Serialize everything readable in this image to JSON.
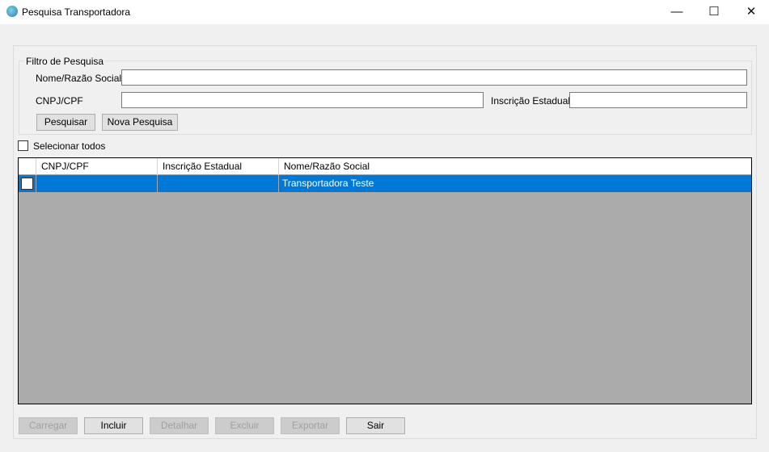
{
  "window": {
    "title": "Pesquisa Transportadora",
    "minimize": "—",
    "maximize": "☐",
    "close": "✕"
  },
  "filter": {
    "legend": "Filtro de Pesquisa",
    "nome_label": "Nome/Razão Social",
    "nome_value": "",
    "cnpj_label": "CNPJ/CPF",
    "cnpj_value": "",
    "ie_label": "Inscrição Estadual",
    "ie_value": "",
    "search_button": "Pesquisar",
    "new_search_button": "Nova Pesquisa"
  },
  "select_all": {
    "label": "Selecionar todos",
    "checked": false
  },
  "grid": {
    "columns": [
      "CNPJ/CPF",
      "Inscrição Estadual",
      "Nome/Razão Social"
    ],
    "rows": [
      {
        "checked": false,
        "cnpj": "",
        "ie": "",
        "nome": "Transportadora Teste",
        "selected": true
      }
    ]
  },
  "buttons": {
    "carregar": "Carregar",
    "incluir": "Incluir",
    "detalhar": "Detalhar",
    "excluir": "Excluir",
    "exportar": "Exportar",
    "sair": "Sair"
  }
}
